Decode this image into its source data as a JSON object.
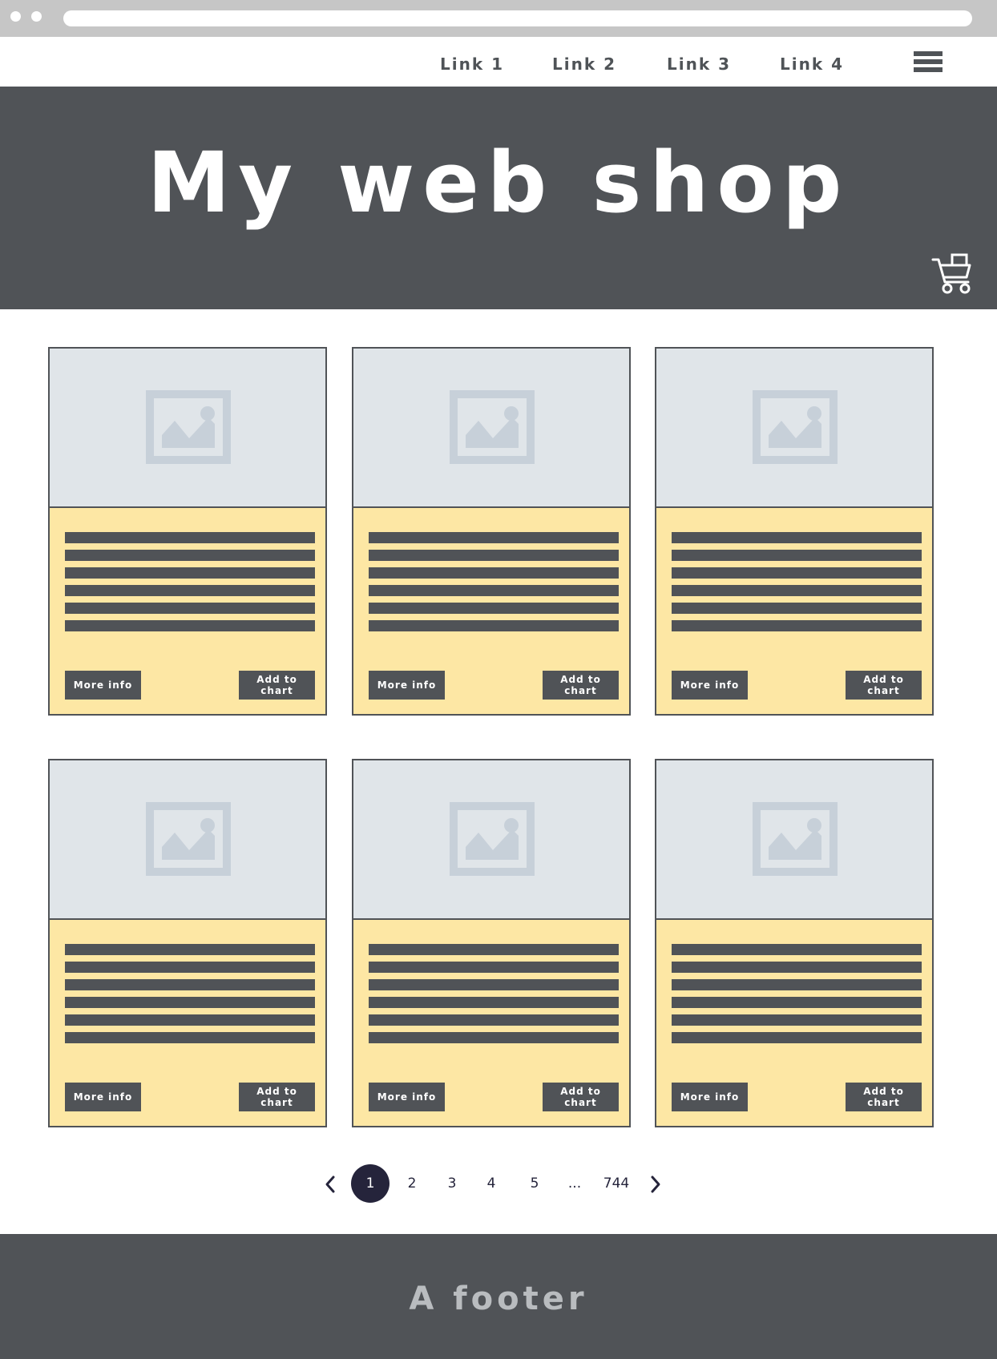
{
  "nav": {
    "links": [
      "Link 1",
      "Link 2",
      "Link 3",
      "Link 4"
    ]
  },
  "hero": {
    "title": "My web shop"
  },
  "products": [
    {
      "more_label": "More info",
      "add_label": "Add to chart"
    },
    {
      "more_label": "More info",
      "add_label": "Add to chart"
    },
    {
      "more_label": "More info",
      "add_label": "Add to chart"
    },
    {
      "more_label": "More info",
      "add_label": "Add to chart"
    },
    {
      "more_label": "More info",
      "add_label": "Add to chart"
    },
    {
      "more_label": "More info",
      "add_label": "Add to chart"
    }
  ],
  "pagination": {
    "pages": [
      "1",
      "2",
      "3",
      "4",
      "5",
      "...",
      "744"
    ],
    "current": "1"
  },
  "footer": {
    "text": "A footer"
  },
  "colors": {
    "dark": "#505357",
    "card_body": "#fde7a4",
    "image_bg": "#e0e5e9",
    "pager_active": "#25243b"
  },
  "icons": {
    "menu": "hamburger-menu-icon",
    "cart": "shopping-cart-icon",
    "image": "image-placeholder-icon",
    "prev": "chevron-left-icon",
    "next": "chevron-right-icon"
  }
}
